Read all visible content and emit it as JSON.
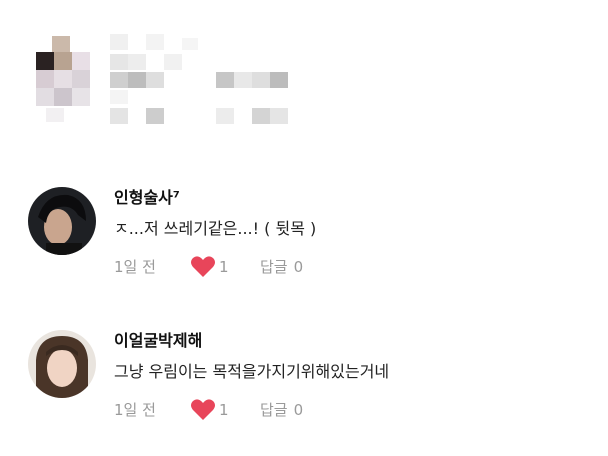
{
  "comments": [
    {
      "author": "인형술사⁷",
      "text": "ㅈ...저 쓰레기같은...! ( 뒷목 )",
      "time": "1일 전",
      "likes": "1",
      "reply_label": "답글",
      "reply_count": "0"
    },
    {
      "author": "이얼굴박제해",
      "text": "그냥 우림이는 목적을가지기위해있는거네",
      "time": "1일 전",
      "likes": "1",
      "reply_label": "답글",
      "reply_count": "0"
    }
  ],
  "colors": {
    "heart": "#e8455a",
    "meta_text": "#9a9a9a",
    "background": "#ffffff"
  },
  "icons": [
    "heart-icon",
    "avatar-image"
  ]
}
